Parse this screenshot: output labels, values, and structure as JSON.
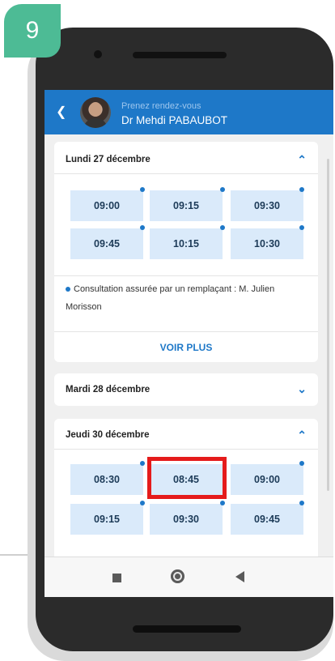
{
  "step": {
    "number": "9"
  },
  "header": {
    "subtitle": "Prenez rendez-vous",
    "doctor": "Dr Mehdi PABAUBOT",
    "back_icon": "chevron-left-icon"
  },
  "days": [
    {
      "label": "Lundi 27 décembre",
      "expanded": true,
      "slots": [
        "09:00",
        "09:15",
        "09:30",
        "09:45",
        "10:15",
        "10:30"
      ],
      "note": "Consultation assurée par un remplaçant : M. Julien Morisson",
      "more_label": "VOIR PLUS"
    },
    {
      "label": "Mardi 28 décembre",
      "expanded": false
    },
    {
      "label": "Jeudi 30 décembre",
      "expanded": true,
      "slots": [
        "08:30",
        "08:45",
        "09:00",
        "09:15",
        "09:30",
        "09:45"
      ],
      "highlighted_slot": "08:45"
    }
  ],
  "colors": {
    "accent": "#1e78c8",
    "slot_bg": "#daeafa",
    "highlight": "#e51b1b",
    "badge": "#4dbb95"
  }
}
